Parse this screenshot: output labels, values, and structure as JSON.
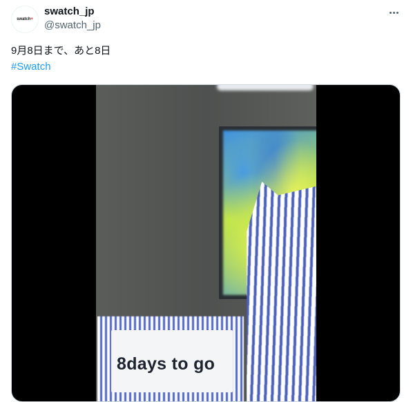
{
  "author": {
    "display_name": "swatch_jp",
    "handle": "@swatch_jp",
    "avatar_text": "swatch",
    "avatar_text_accent": "+"
  },
  "tweet": {
    "text": "9月8日まで、あと8日",
    "hashtag": "#Swatch"
  },
  "media": {
    "type": "video",
    "box_text": "8days to go"
  },
  "icons": {
    "more": "more-horizontal-icon"
  },
  "colors": {
    "link": "#1d9bf0",
    "secondary_text": "#536471",
    "primary_text": "#0f1419",
    "stripe_blue": "#4a5fb8"
  }
}
